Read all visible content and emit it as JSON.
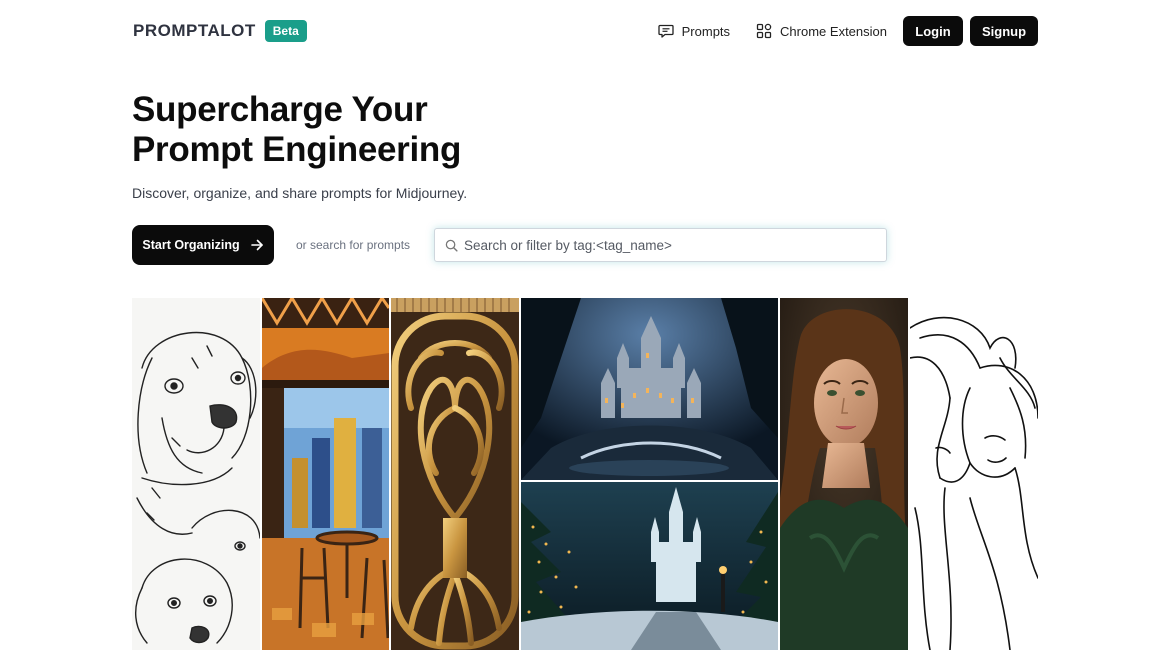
{
  "header": {
    "brand": "PROMPTALOT",
    "badge": "Beta",
    "nav": {
      "prompts": "Prompts",
      "chrome_extension": "Chrome Extension",
      "login": "Login",
      "signup": "Signup"
    }
  },
  "hero": {
    "title_line1": "Supercharge Your",
    "title_line2": "Prompt Engineering",
    "subtitle": "Discover, organize, and share prompts for Midjourney.",
    "cta_label": "Start Organizing",
    "or_text": "or search for prompts",
    "search_placeholder": "Search or filter by tag:<tag_name>",
    "search_value": ""
  },
  "icons": {
    "prompts": "chat-bubble-icon",
    "chrome_extension": "puzzle-grid-icon",
    "cta": "arrow-right-icon",
    "search": "search-icon"
  },
  "colors": {
    "badge": "#1a9e8a",
    "button": "#0b0b0b",
    "search_glow": "#50b4be"
  }
}
